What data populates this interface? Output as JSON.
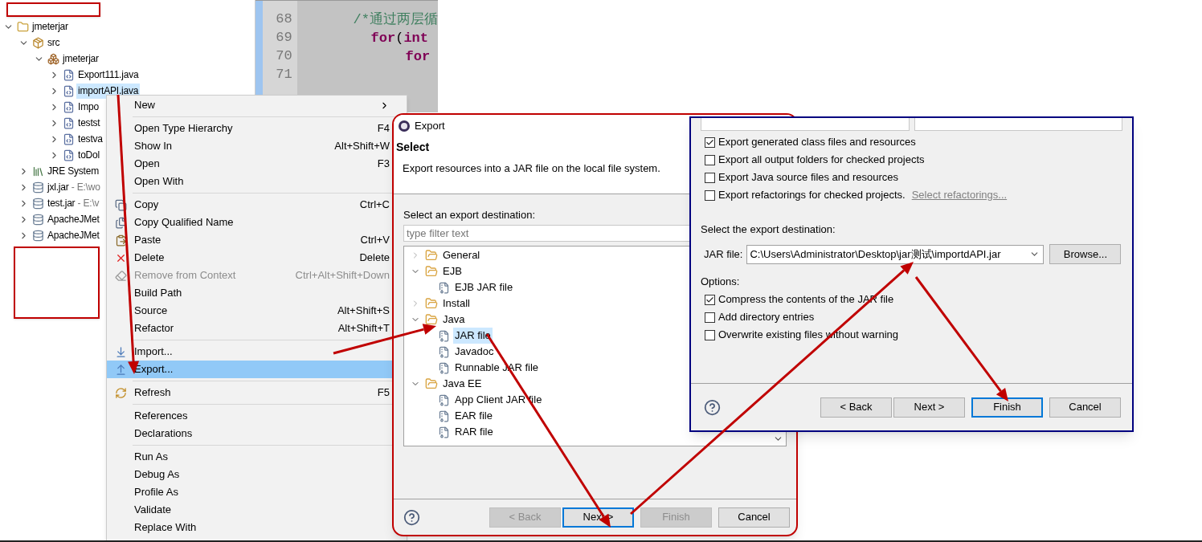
{
  "explorer": {
    "tree": [
      {
        "label": "jmeterjar",
        "kind": "project",
        "expanded": true,
        "selected": false,
        "children": [
          {
            "label": "src",
            "kind": "source",
            "expanded": true,
            "selected": false,
            "children": [
              {
                "label": "jmeterjar",
                "kind": "package",
                "expanded": true,
                "selected": false,
                "children": [
                  {
                    "label": "Export111.java",
                    "kind": "file",
                    "expanded": false,
                    "selected": false
                  },
                  {
                    "label": "importAPI.java",
                    "kind": "file",
                    "expanded": false,
                    "selected": true
                  },
                  {
                    "label": "Impo",
                    "kind": "file",
                    "expanded": false,
                    "selected": false
                  },
                  {
                    "label": "testst",
                    "kind": "file",
                    "expanded": false,
                    "selected": false
                  },
                  {
                    "label": "testva",
                    "kind": "file",
                    "expanded": false,
                    "selected": false
                  },
                  {
                    "label": "toDol",
                    "kind": "file",
                    "expanded": false,
                    "selected": false
                  }
                ]
              }
            ]
          },
          {
            "label": "JRE System",
            "kind": "library",
            "expanded": false,
            "selected": false
          },
          {
            "label": "jxl.jar",
            "detail": "- E:\\wo",
            "kind": "archive",
            "expanded": false,
            "selected": false
          },
          {
            "label": "test.jar",
            "detail": "- E:\\v",
            "kind": "archive",
            "expanded": false,
            "selected": false
          },
          {
            "label": "ApacheJMet",
            "kind": "archive",
            "expanded": false,
            "selected": false
          },
          {
            "label": "ApacheJMet",
            "kind": "archive",
            "expanded": false,
            "selected": false
          }
        ]
      }
    ]
  },
  "editor": {
    "lines": [
      {
        "number": "68",
        "tokens": [
          {
            "text": "/*通过两层循",
            "kind": "comment"
          }
        ]
      },
      {
        "number": "69",
        "tokens": [
          {
            "text": "for",
            "kind": "keyword"
          },
          {
            "text": "(",
            "kind": "plain"
          },
          {
            "text": "int",
            "kind": "keyword"
          }
        ]
      },
      {
        "number": "70",
        "tokens": [
          {
            "text": "for",
            "kind": "keyword"
          }
        ]
      },
      {
        "number": "71"
      }
    ]
  },
  "context_menu": {
    "items": [
      {
        "kind": "plain",
        "label": "New",
        "submenu": true,
        "disabled": false,
        "selected": false
      },
      {
        "kind": "separator"
      },
      {
        "kind": "plain",
        "label": "Open Type Hierarchy",
        "shortcut": "F4",
        "disabled": false,
        "selected": false
      },
      {
        "kind": "plain",
        "label": "Show In",
        "shortcut": "Alt+Shift+W",
        "disabled": false,
        "selected": false
      },
      {
        "kind": "plain",
        "label": "Open",
        "shortcut": "F3",
        "disabled": false,
        "selected": false
      },
      {
        "kind": "plain",
        "label": "Open With",
        "disabled": false,
        "selected": false
      },
      {
        "kind": "separator"
      },
      {
        "kind": "copy",
        "label": "Copy",
        "shortcut": "Ctrl+C",
        "disabled": false,
        "selected": false
      },
      {
        "kind": "copyname",
        "label": "Copy Qualified Name",
        "disabled": false,
        "selected": false
      },
      {
        "kind": "paste",
        "label": "Paste",
        "shortcut": "Ctrl+V",
        "disabled": false,
        "selected": false
      },
      {
        "kind": "delete",
        "label": "Delete",
        "shortcut": "Delete",
        "disabled": false,
        "selected": false
      },
      {
        "kind": "remove",
        "label": "Remove from Context",
        "shortcut": "Ctrl+Alt+Shift+Down",
        "disabled": true,
        "selected": false
      },
      {
        "kind": "plain",
        "label": "Build Path",
        "disabled": false,
        "selected": false
      },
      {
        "kind": "plain",
        "label": "Source",
        "shortcut": "Alt+Shift+S",
        "disabled": false,
        "selected": false
      },
      {
        "kind": "plain",
        "label": "Refactor",
        "shortcut": "Alt+Shift+T",
        "disabled": false,
        "selected": false
      },
      {
        "kind": "separator"
      },
      {
        "kind": "import",
        "label": "Import...",
        "disabled": false,
        "selected": false
      },
      {
        "kind": "export",
        "label": "Export...",
        "disabled": false,
        "selected": true
      },
      {
        "kind": "separator"
      },
      {
        "kind": "refresh",
        "label": "Refresh",
        "shortcut": "F5",
        "disabled": false,
        "selected": false
      },
      {
        "kind": "separator"
      },
      {
        "kind": "plain",
        "label": "References",
        "disabled": false,
        "selected": false
      },
      {
        "kind": "plain",
        "label": "Declarations",
        "disabled": false,
        "selected": false
      },
      {
        "kind": "separator"
      },
      {
        "kind": "plain",
        "label": "Run As",
        "disabled": false,
        "selected": false
      },
      {
        "kind": "plain",
        "label": "Debug As",
        "disabled": false,
        "selected": false
      },
      {
        "kind": "plain",
        "label": "Profile As",
        "disabled": false,
        "selected": false
      },
      {
        "kind": "plain",
        "label": "Validate",
        "disabled": false,
        "selected": false
      },
      {
        "kind": "plain",
        "label": "Replace With",
        "disabled": false,
        "selected": false
      }
    ]
  },
  "export_dialog": {
    "title": "Export",
    "heading": "Select",
    "description": "Export resources into a JAR file on the local file system.",
    "destination_label": "Select an export destination:",
    "filter": {
      "placeholder": "type filter text"
    },
    "wizards": [
      {
        "label": "General",
        "expanded": false
      },
      {
        "label": "EJB",
        "expanded": true,
        "children": [
          {
            "label": "EJB JAR file",
            "selected": false
          }
        ]
      },
      {
        "label": "Install",
        "expanded": false
      },
      {
        "label": "Java",
        "expanded": true,
        "children": [
          {
            "label": "JAR file",
            "selected": true
          },
          {
            "label": "Javadoc",
            "selected": false
          },
          {
            "label": "Runnable JAR file",
            "selected": false
          }
        ]
      },
      {
        "label": "Java EE",
        "expanded": true,
        "children": [
          {
            "label": "App Client JAR file",
            "selected": false
          },
          {
            "label": "EAR file",
            "selected": false
          },
          {
            "label": "RAR file",
            "selected": false
          }
        ]
      }
    ],
    "buttons": [
      {
        "label": "< Back",
        "disabled": true,
        "focused": false
      },
      {
        "label": "Next >",
        "disabled": false,
        "focused": true
      },
      {
        "label": "Finish",
        "disabled": true,
        "focused": false
      },
      {
        "label": "Cancel",
        "disabled": false,
        "focused": false
      }
    ]
  },
  "jar_export_page": {
    "options_top": [
      {
        "label": "Export generated class files and resources",
        "checked": true
      },
      {
        "label": "Export all output folders for checked projects",
        "checked": false
      },
      {
        "label": "Export Java source files and resources",
        "checked": false
      },
      {
        "label": "Export refactorings for checked projects.",
        "checked": false,
        "link": "Select refactorings..."
      }
    ],
    "destination_label": "Select the export destination:",
    "jar_file_label": "JAR file:",
    "jar_file": "C:\\Users\\Administrator\\Desktop\\jar测试\\importdAPI.jar",
    "browse": "Browse...",
    "options_label": "Options:",
    "options": [
      {
        "label": "Compress the contents of the JAR file",
        "checked": true
      },
      {
        "label": "Add directory entries",
        "checked": false
      },
      {
        "label": "Overwrite existing files without warning",
        "checked": false
      }
    ],
    "buttons": [
      {
        "label": "< Back",
        "disabled": false,
        "focused": false
      },
      {
        "label": "Next >",
        "disabled": false,
        "focused": false
      },
      {
        "label": "Finish",
        "disabled": false,
        "focused": true
      },
      {
        "label": "Cancel",
        "disabled": false,
        "focused": false
      }
    ]
  }
}
